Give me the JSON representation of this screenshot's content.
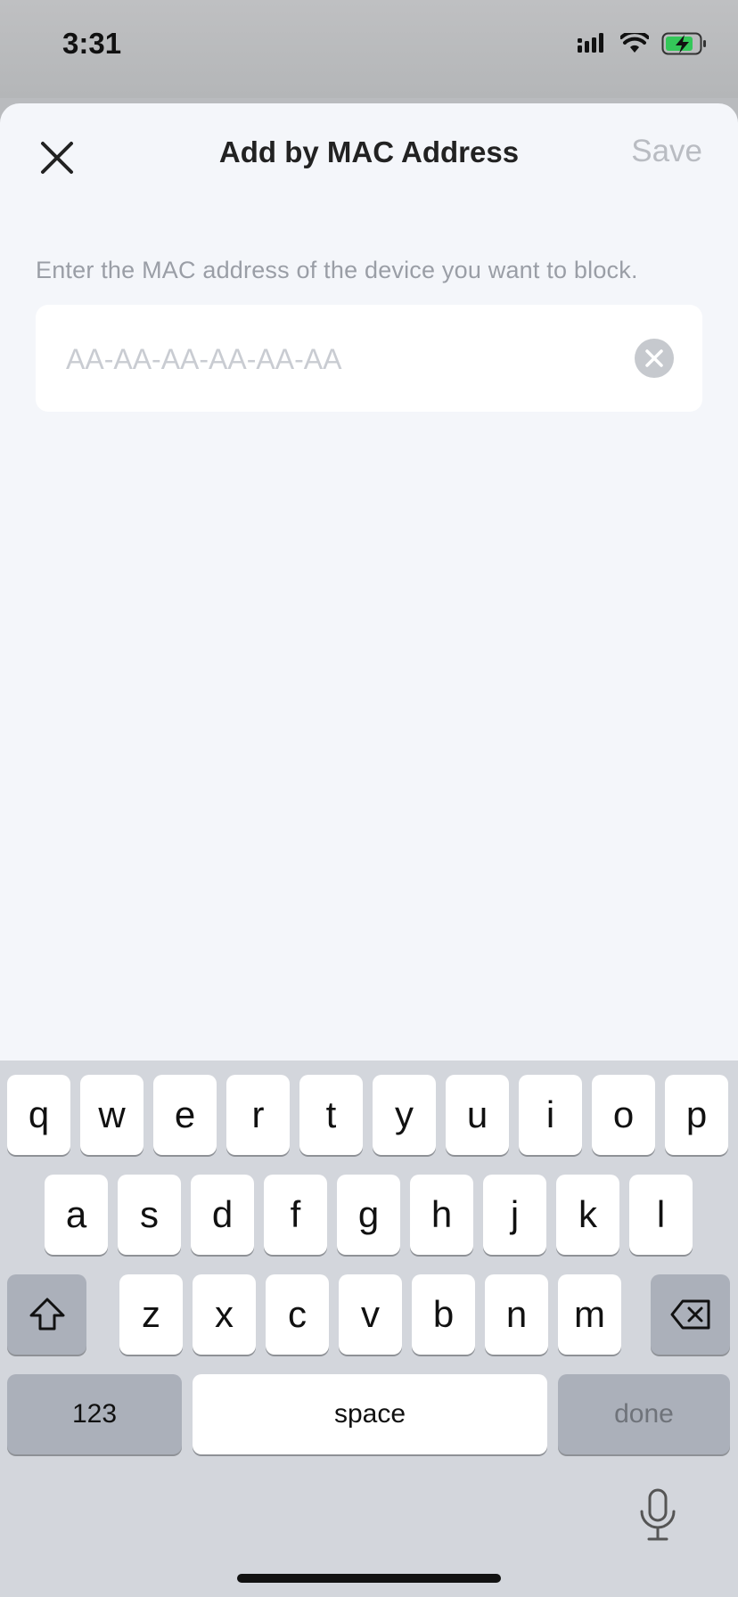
{
  "status_bar": {
    "time": "3:31"
  },
  "header": {
    "title": "Add by MAC Address",
    "save_label": "Save"
  },
  "form": {
    "instruction": "Enter the MAC address of the device you want to block.",
    "mac_value": "",
    "mac_placeholder": "AA-AA-AA-AA-AA-AA"
  },
  "keyboard": {
    "row1": [
      "q",
      "w",
      "e",
      "r",
      "t",
      "y",
      "u",
      "i",
      "o",
      "p"
    ],
    "row2": [
      "a",
      "s",
      "d",
      "f",
      "g",
      "h",
      "j",
      "k",
      "l"
    ],
    "row3": [
      "z",
      "x",
      "c",
      "v",
      "b",
      "n",
      "m"
    ],
    "numbers_label": "123",
    "space_label": "space",
    "done_label": "done"
  },
  "colors": {
    "sheet_background": "#f4f6fa",
    "save_disabled": "#b9bcc2",
    "keyboard_background": "#d3d6dc"
  }
}
